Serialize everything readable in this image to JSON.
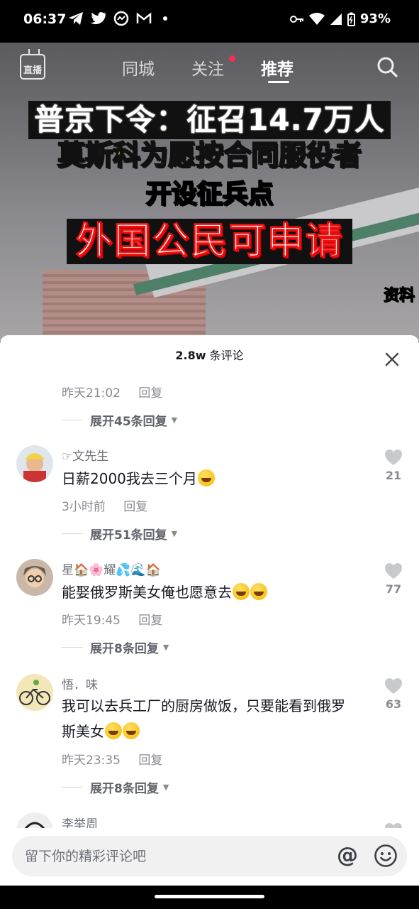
{
  "status_bar": {
    "time": "06:37",
    "battery": "93%",
    "notification_icons": [
      "telegram-icon",
      "twitter-icon",
      "messenger-icon",
      "gmail-icon",
      "dot"
    ]
  },
  "top_nav": {
    "live_label": "直播",
    "tabs": [
      {
        "label": "同城",
        "active": false
      },
      {
        "label": "关注",
        "active": false,
        "badge": true
      },
      {
        "label": "推荐",
        "active": true
      }
    ]
  },
  "video": {
    "headline_1": "普京下令：征召14.7万人",
    "headline_2": "莫斯科为愿按合同服役者",
    "headline_3": "开设征兵点",
    "headline_4": "外国公民可申请",
    "source_tag": "资料"
  },
  "comments_panel": {
    "count": "2.8w",
    "count_suffix": "条评论",
    "items": [
      {
        "partial": true,
        "time": "昨天21:02",
        "reply": "回复",
        "expand": "展开45条回复"
      },
      {
        "username": "☞文先生",
        "text": "日薪2000我去三个月",
        "emoji_count": 1,
        "time": "3小时前",
        "reply": "回复",
        "expand": "展开51条回复",
        "likes": "21"
      },
      {
        "username": "星🏠🌸耀💦🌊🏠",
        "text": "能娶俄罗斯美女俺也愿意去",
        "emoji_count": 2,
        "time": "昨天19:45",
        "reply": "回复",
        "expand": "展开8条回复",
        "likes": "77"
      },
      {
        "username": "悟．味",
        "text_line1": "我可以去兵工厂的厨房做饭，只要能看到俄罗",
        "text_line2": "斯美女",
        "emoji_count": 2,
        "time": "昨天23:35",
        "reply": "回复",
        "expand": "展开8条回复",
        "likes": "63"
      },
      {
        "username": "李举周"
      }
    ]
  },
  "input_bar": {
    "placeholder": "留下你的精彩评论吧"
  },
  "colors": {
    "accent_red": "#ff2b54",
    "headline_yellow": "#ffe43a",
    "text_primary": "#161823",
    "text_secondary": "#8a8b91"
  }
}
